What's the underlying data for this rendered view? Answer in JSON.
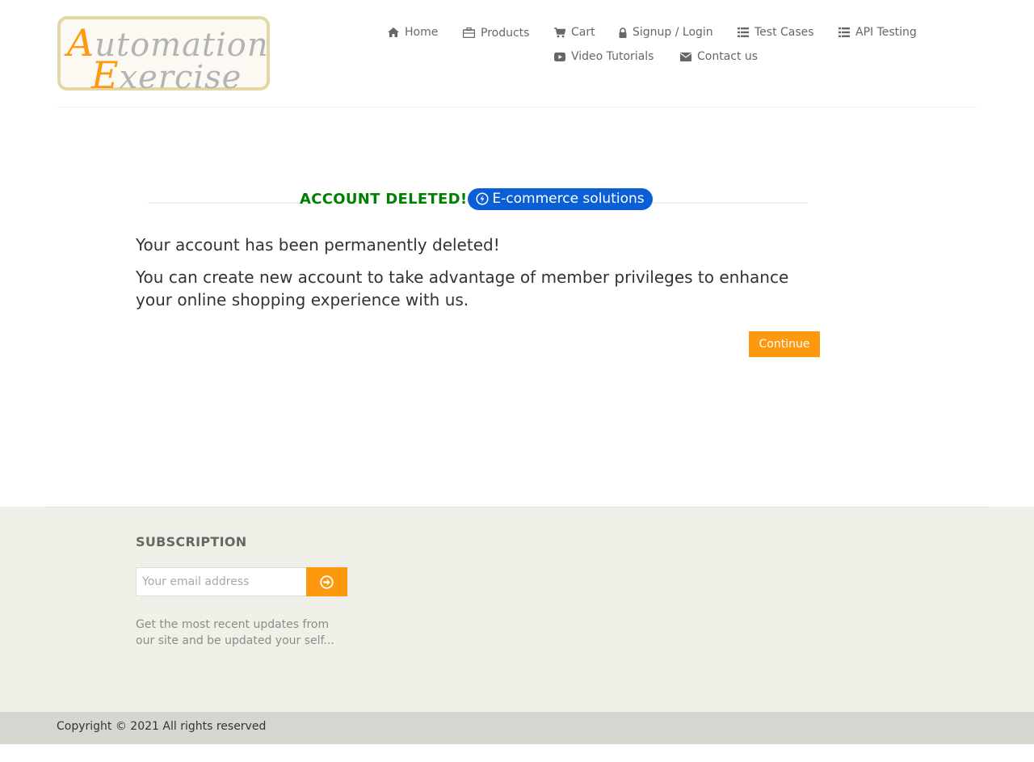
{
  "logo": {
    "line1_first": "A",
    "line1_rest": "utomation",
    "line2_first": "E",
    "line2_rest": "xercise"
  },
  "nav": {
    "home": "Home",
    "products": "Products",
    "cart": "Cart",
    "signup_login": "Signup / Login",
    "test_cases": "Test Cases",
    "api_testing": "API Testing",
    "video_tutorials": "Video Tutorials",
    "contact_us": "Contact us"
  },
  "main": {
    "title": "ACCOUNT DELETED!",
    "badge": "E-commerce solutions",
    "message1": "Your account has been permanently deleted!",
    "message2": "You can create new account to take advantage of member privileges to enhance your online shopping experience with us.",
    "continue_label": "Continue"
  },
  "footer": {
    "subscription_title": "SUBSCRIPTION",
    "email_placeholder": "Your email address",
    "description": "Get the most recent updates from our site and be updated your self...",
    "copyright": "Copyright © 2021 All rights reserved"
  },
  "colors": {
    "accent": "#fe980f",
    "success": "#008000",
    "badge": "#0b5fd6",
    "footer_bg": "#f0f0e9"
  }
}
